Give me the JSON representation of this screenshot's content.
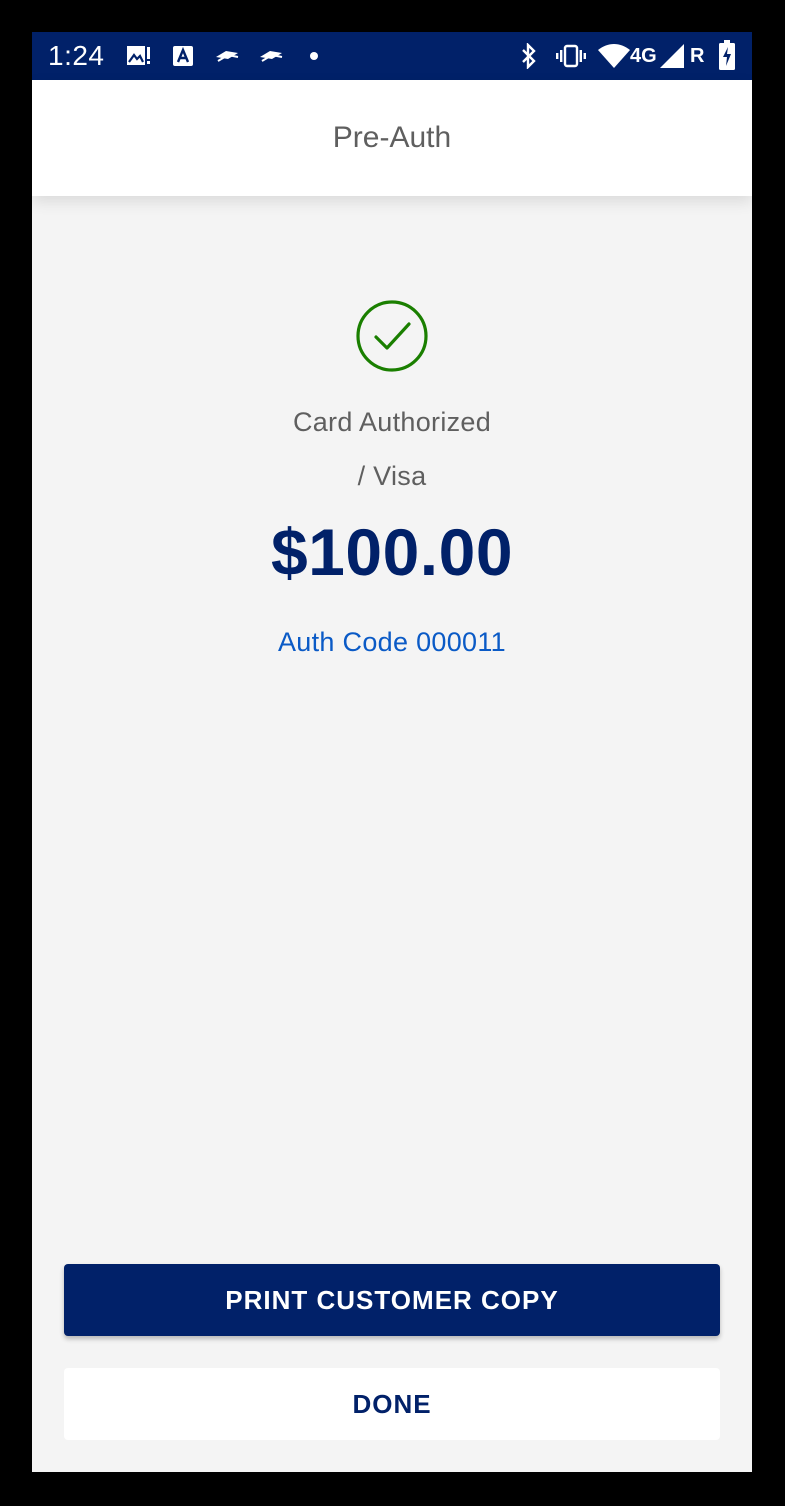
{
  "status_bar": {
    "time": "1:24",
    "network": "4G",
    "roaming": "R",
    "icons": [
      "image-alert-icon",
      "app-a-icon",
      "bank-flag-icon",
      "bank-flag-icon",
      "dot-icon",
      "bluetooth-icon",
      "vibrate-icon",
      "wifi-icon",
      "signal-icon",
      "battery-charging-icon"
    ]
  },
  "app_bar": {
    "title": "Pre-Auth"
  },
  "result": {
    "icon": "check-circle-icon",
    "status": "Card Authorized",
    "card": "/ Visa",
    "amount": "$100.00",
    "auth_code": "Auth Code 000011"
  },
  "actions": {
    "print_label": "PRINT CUSTOMER COPY",
    "done_label": "DONE"
  },
  "colors": {
    "brand_navy": "#012169",
    "success_green": "#1a7f00",
    "link_blue": "#0a5ac6",
    "background": "#f4f4f4"
  }
}
